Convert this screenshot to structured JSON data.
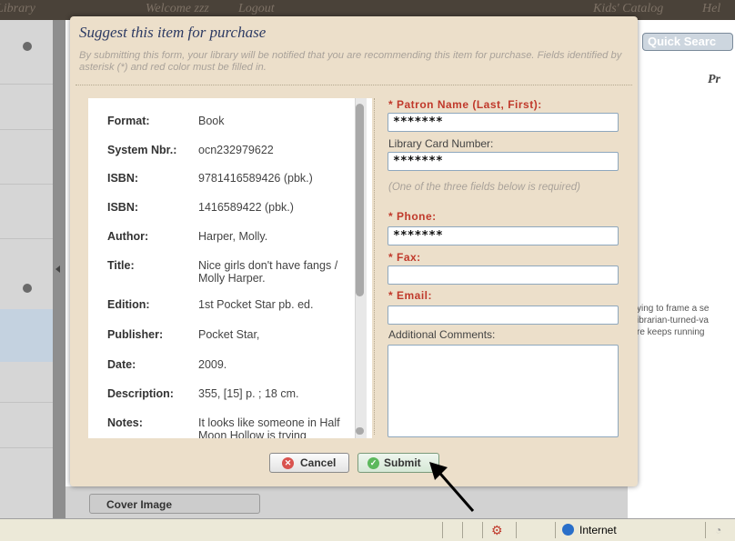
{
  "header": {
    "library": "Library",
    "welcome": "Welcome  zzz",
    "logout": "Logout",
    "kids_catalog": "Kids' Catalog",
    "help": "Hel"
  },
  "background": {
    "quick_search": "Quick Searc",
    "right_heading": "Pr",
    "snippet": [
      "ying to frame a se",
      "ibrarian-turned-va",
      "re keeps running"
    ],
    "cover_image_button": "Cover Image"
  },
  "dialog": {
    "title": "Suggest this item for purchase",
    "description": "By submitting this form, your library will be notified that you are recommending this item for purchase. Fields identified by asterisk (*) and red color must be filled in.",
    "item_info": [
      {
        "label": "Format:",
        "value": "Book"
      },
      {
        "label": "System Nbr.:",
        "value": "ocn232979622"
      },
      {
        "label": "ISBN:",
        "value": "9781416589426 (pbk.)"
      },
      {
        "label": "ISBN:",
        "value": "1416589422 (pbk.)"
      },
      {
        "label": "Author:",
        "value": "Harper, Molly."
      },
      {
        "label": "Title:",
        "value": "Nice girls don't have fangs / Molly Harper."
      },
      {
        "label": "Edition:",
        "value": "1st Pocket Star pb. ed."
      },
      {
        "label": "Publisher:",
        "value": "Pocket Star,"
      },
      {
        "label": "Date:",
        "value": "2009."
      },
      {
        "label": "Description:",
        "value": "355, [15] p. ;  18 cm."
      },
      {
        "label": "Notes:",
        "value": "It looks like someone in Half Moon Hollow is trying"
      }
    ],
    "form": {
      "patron_name_label": "* Patron Name (Last, First):",
      "patron_name_value": "*******",
      "card_number_label": "Library Card Number:",
      "card_number_value": "*******",
      "required_note": "(One of the three fields below is required)",
      "phone_label": "* Phone:",
      "phone_value": "*******",
      "fax_label": "* Fax:",
      "fax_value": "",
      "email_label": "* Email:",
      "email_value": "",
      "comments_label": "Additional Comments:",
      "comments_value": ""
    },
    "buttons": {
      "cancel": "Cancel",
      "submit": "Submit"
    }
  },
  "statusbar": {
    "zone": "Internet"
  },
  "colors": {
    "dialog_bg": "#ecdfca",
    "title": "#2c3a63",
    "required": "#c0392b",
    "input_border": "#8ea7bd"
  },
  "icons": [
    "settings-gear-icon",
    "cancel-x-icon",
    "submit-check-icon",
    "lock-icon",
    "globe-icon",
    "mouse-pointer-icon"
  ]
}
